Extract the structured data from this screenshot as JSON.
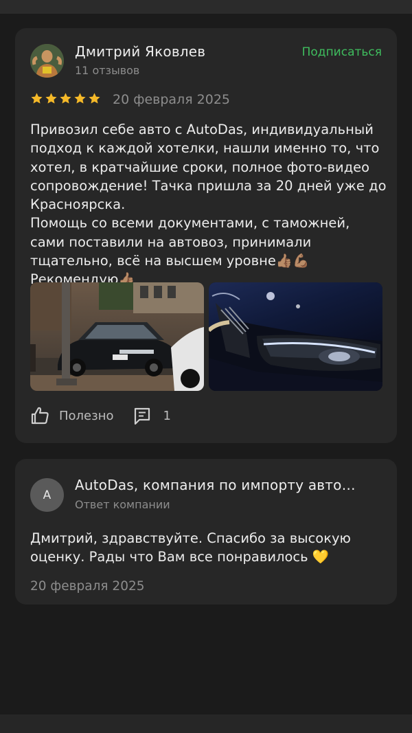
{
  "review": {
    "author_name": "Дмитрий Яковлев",
    "author_reviews": "11 отзывов",
    "subscribe_label": "Подписаться",
    "rating": 5,
    "date": "20 февраля 2025",
    "text": "Привозил себе авто с AutoDas, индивидуальный подход к каждой хотелки, нашли именно то, что хотел, в кратчайшие сроки, полное фото-видео сопровождение! Тачка пришла за 20 дней уже до Красноярска.\nПомощь со всеми документами, с таможней, сами поставили на автовоз, принимали тщательно, всё на высшем уровне👍🏽💪🏽 Рекомендую👍🏽",
    "photos": [
      "car-photo-street",
      "car-photo-headlight"
    ],
    "helpful_label": "Полезно",
    "comments_count": "1"
  },
  "reply": {
    "avatar_letter": "A",
    "company_name": "AutoDas, компания по импорту авто…",
    "company_sub": "Ответ компании",
    "text": "Дмитрий, здравствуйте. Спасибо за высокую оценку. Рады что Вам все понравилось 💛",
    "date": "20 февраля 2025"
  },
  "colors": {
    "background": "#1b1b1b",
    "card": "#272727",
    "accent_green": "#3fbd5e",
    "star_gold": "#f5b929",
    "muted_text": "#8d8d8d"
  }
}
